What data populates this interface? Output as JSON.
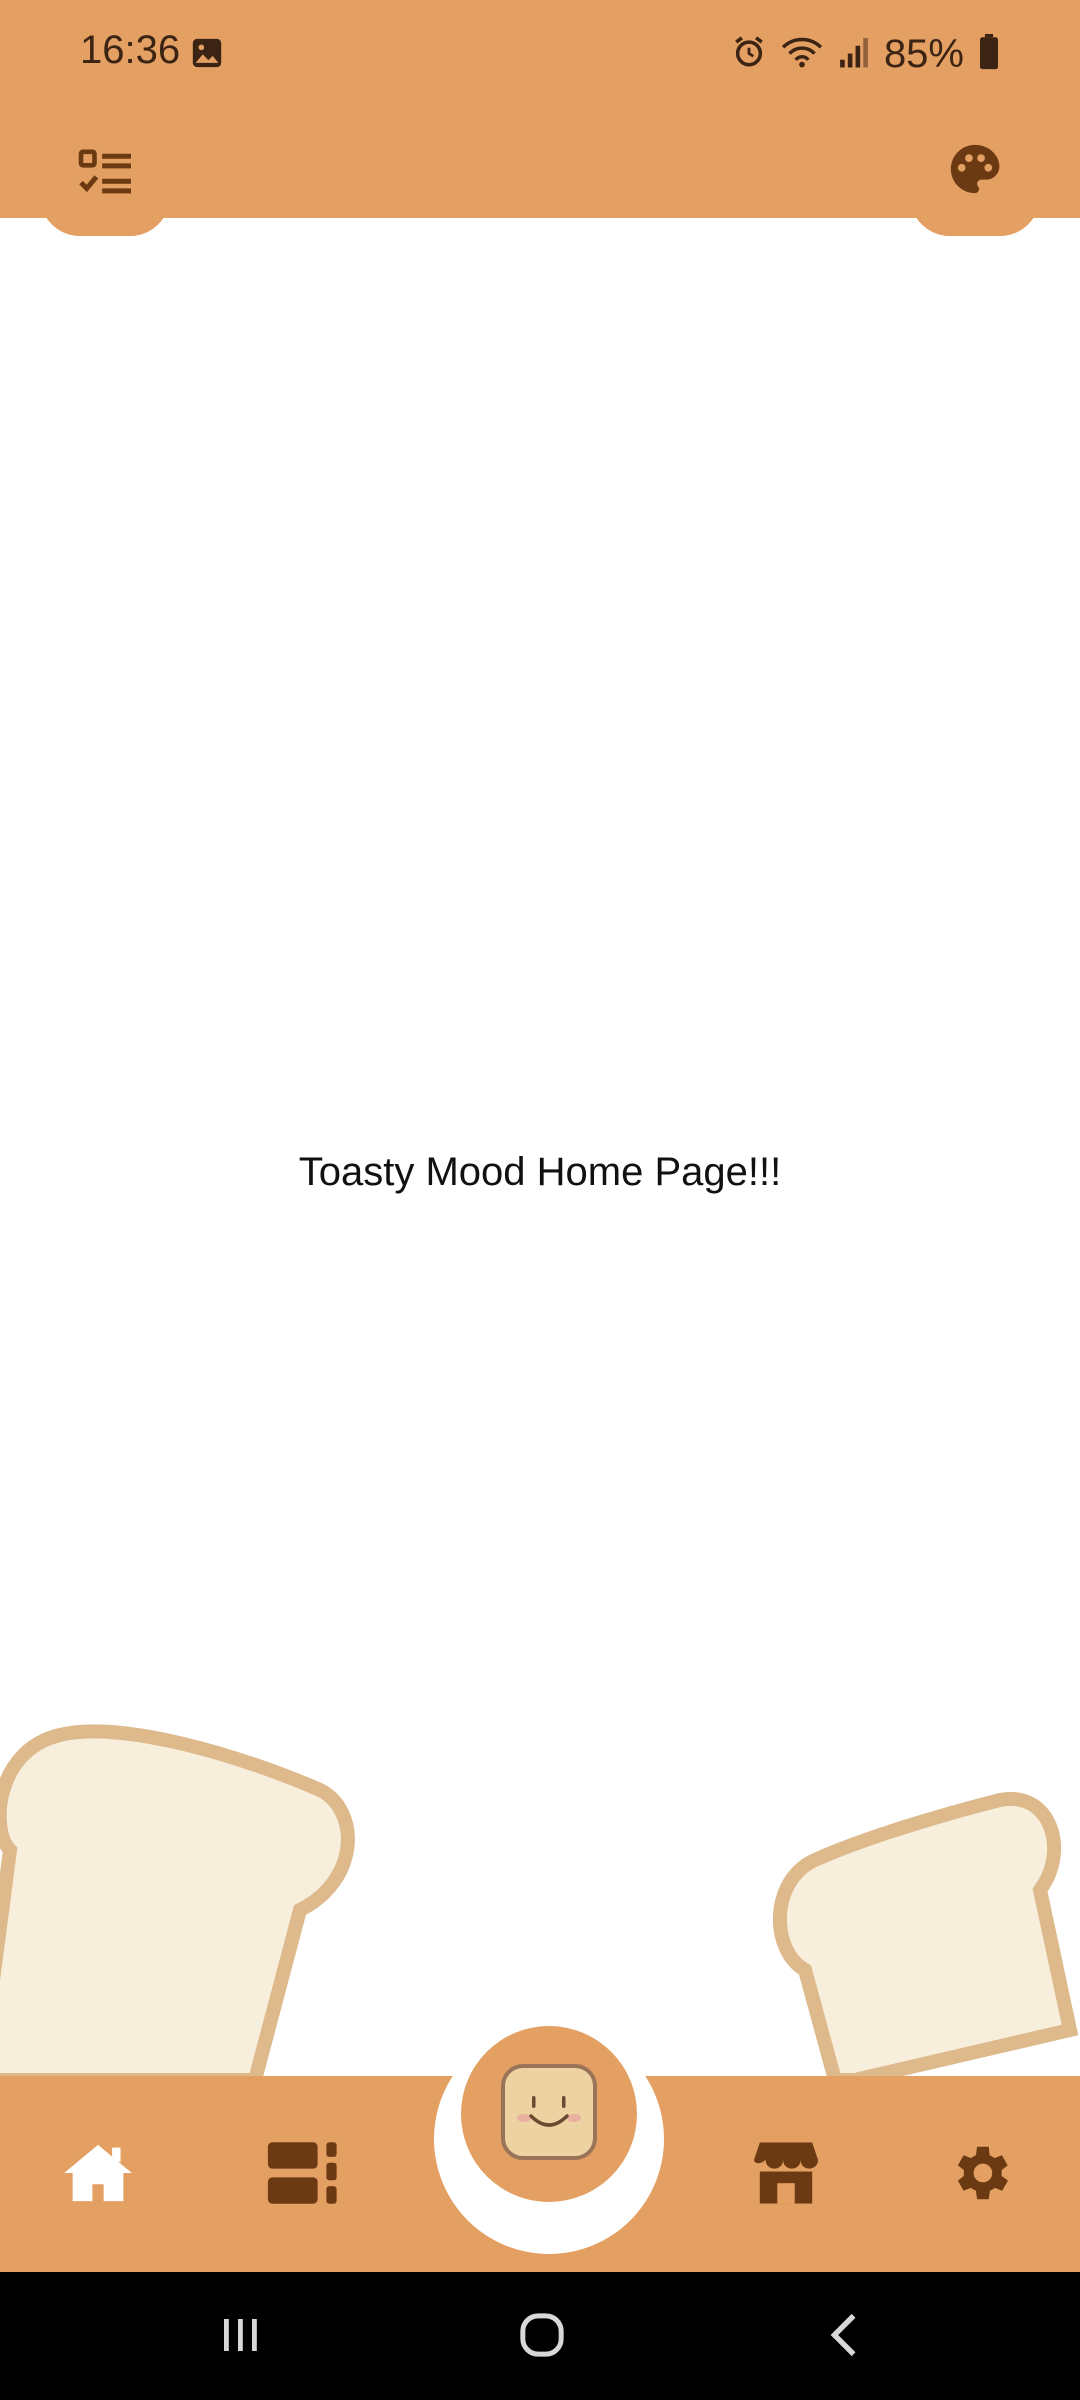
{
  "status_bar": {
    "time": "16:36",
    "battery_percent": "85%",
    "icons": [
      "gallery-icon",
      "alarm-icon",
      "wifi-icon",
      "signal-icon",
      "battery-icon"
    ]
  },
  "top_bar": {
    "left_icon": "checklist-icon",
    "right_icon": "palette-icon"
  },
  "main": {
    "text": "Toasty Mood Home Page!!!"
  },
  "bottom_nav": {
    "items": [
      "home-icon",
      "dashboard-icon",
      "smiley-toast-icon",
      "store-icon",
      "settings-icon"
    ]
  },
  "system_nav": [
    "recents-icon",
    "home-circle-icon",
    "back-icon"
  ],
  "colors": {
    "accent": "#E49F62",
    "icon_dark": "#6B3A12",
    "toast_fill": "#F8EEDC",
    "toast_crust": "#DDB98C"
  }
}
